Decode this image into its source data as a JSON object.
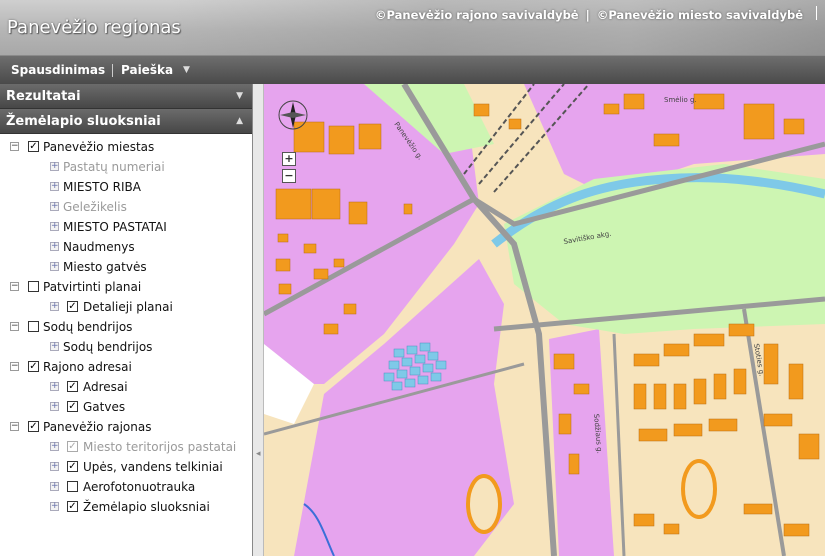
{
  "header": {
    "title": "Panevėžio regionas",
    "credits": [
      "©Panevėžio rajono savivaldybė",
      "©Panevėžio miesto savivaldybė"
    ]
  },
  "menu": {
    "items": [
      {
        "label": "Spausdinimas"
      },
      {
        "label": "Paieška"
      }
    ]
  },
  "panels": {
    "results": {
      "title": "Rezultatai"
    },
    "layers": {
      "title": "Žemėlapio sluoksniai"
    }
  },
  "tree": [
    {
      "label": "Panevėžio miestas",
      "level": 0,
      "expanded": true,
      "checked": true,
      "dim": false
    },
    {
      "label": "Pastatų numeriai",
      "level": 1,
      "checkbox": false,
      "dim": true
    },
    {
      "label": "MIESTO RIBA",
      "level": 1,
      "checkbox": false,
      "dim": false
    },
    {
      "label": "Geležikelis",
      "level": 1,
      "checkbox": false,
      "dim": true
    },
    {
      "label": "MIESTO PASTATAI",
      "level": 1,
      "checkbox": false,
      "dim": false
    },
    {
      "label": "Naudmenys",
      "level": 1,
      "checkbox": false,
      "dim": false
    },
    {
      "label": "Miesto gatvės",
      "level": 1,
      "checkbox": false,
      "dim": false
    },
    {
      "label": "Patvirtinti planai",
      "level": 0,
      "expanded": true,
      "checked": false,
      "dim": false
    },
    {
      "label": "Detalieji planai",
      "level": 1,
      "checkbox": true,
      "checked": true,
      "dim": false
    },
    {
      "label": "Sodų bendrijos",
      "level": 0,
      "expanded": true,
      "checked": false,
      "dim": false
    },
    {
      "label": "Sodų bendrijos",
      "level": 1,
      "checkbox": false,
      "dim": false
    },
    {
      "label": "Rajono adresai",
      "level": 0,
      "expanded": true,
      "checked": true,
      "dim": false
    },
    {
      "label": "Adresai",
      "level": 1,
      "checkbox": true,
      "checked": true,
      "dim": false
    },
    {
      "label": "Gatves",
      "level": 1,
      "checkbox": true,
      "checked": true,
      "dim": false
    },
    {
      "label": "Panevėžio rajonas",
      "level": 0,
      "expanded": true,
      "checked": true,
      "dim": false
    },
    {
      "label": "Miesto teritorijos pastatai",
      "level": 1,
      "checkbox": true,
      "checked": true,
      "disabled": true,
      "dim": true
    },
    {
      "label": "Upės, vandens telkiniai",
      "level": 1,
      "checkbox": true,
      "checked": true,
      "dim": false
    },
    {
      "label": "Aerofotonuotrauka",
      "level": 1,
      "checkbox": true,
      "checked": false,
      "dim": false
    },
    {
      "label": "Žemėlapio sluoksniai",
      "level": 1,
      "checkbox": true,
      "checked": true,
      "dim": false
    }
  ],
  "map": {
    "street_labels": [
      "Panevėžio g.",
      "Smėlio g.",
      "Savitiško akg.",
      "Sodžiaus g.",
      "Stoties g."
    ],
    "zoom_in": "+",
    "zoom_out": "−",
    "colors": {
      "residential": "#f7e4bd",
      "industrial": "#e6a4ee",
      "building": "#f29a1e",
      "water": "#7ec9e8",
      "park": "#cdf5b2",
      "road": "#9a9a9a"
    }
  }
}
